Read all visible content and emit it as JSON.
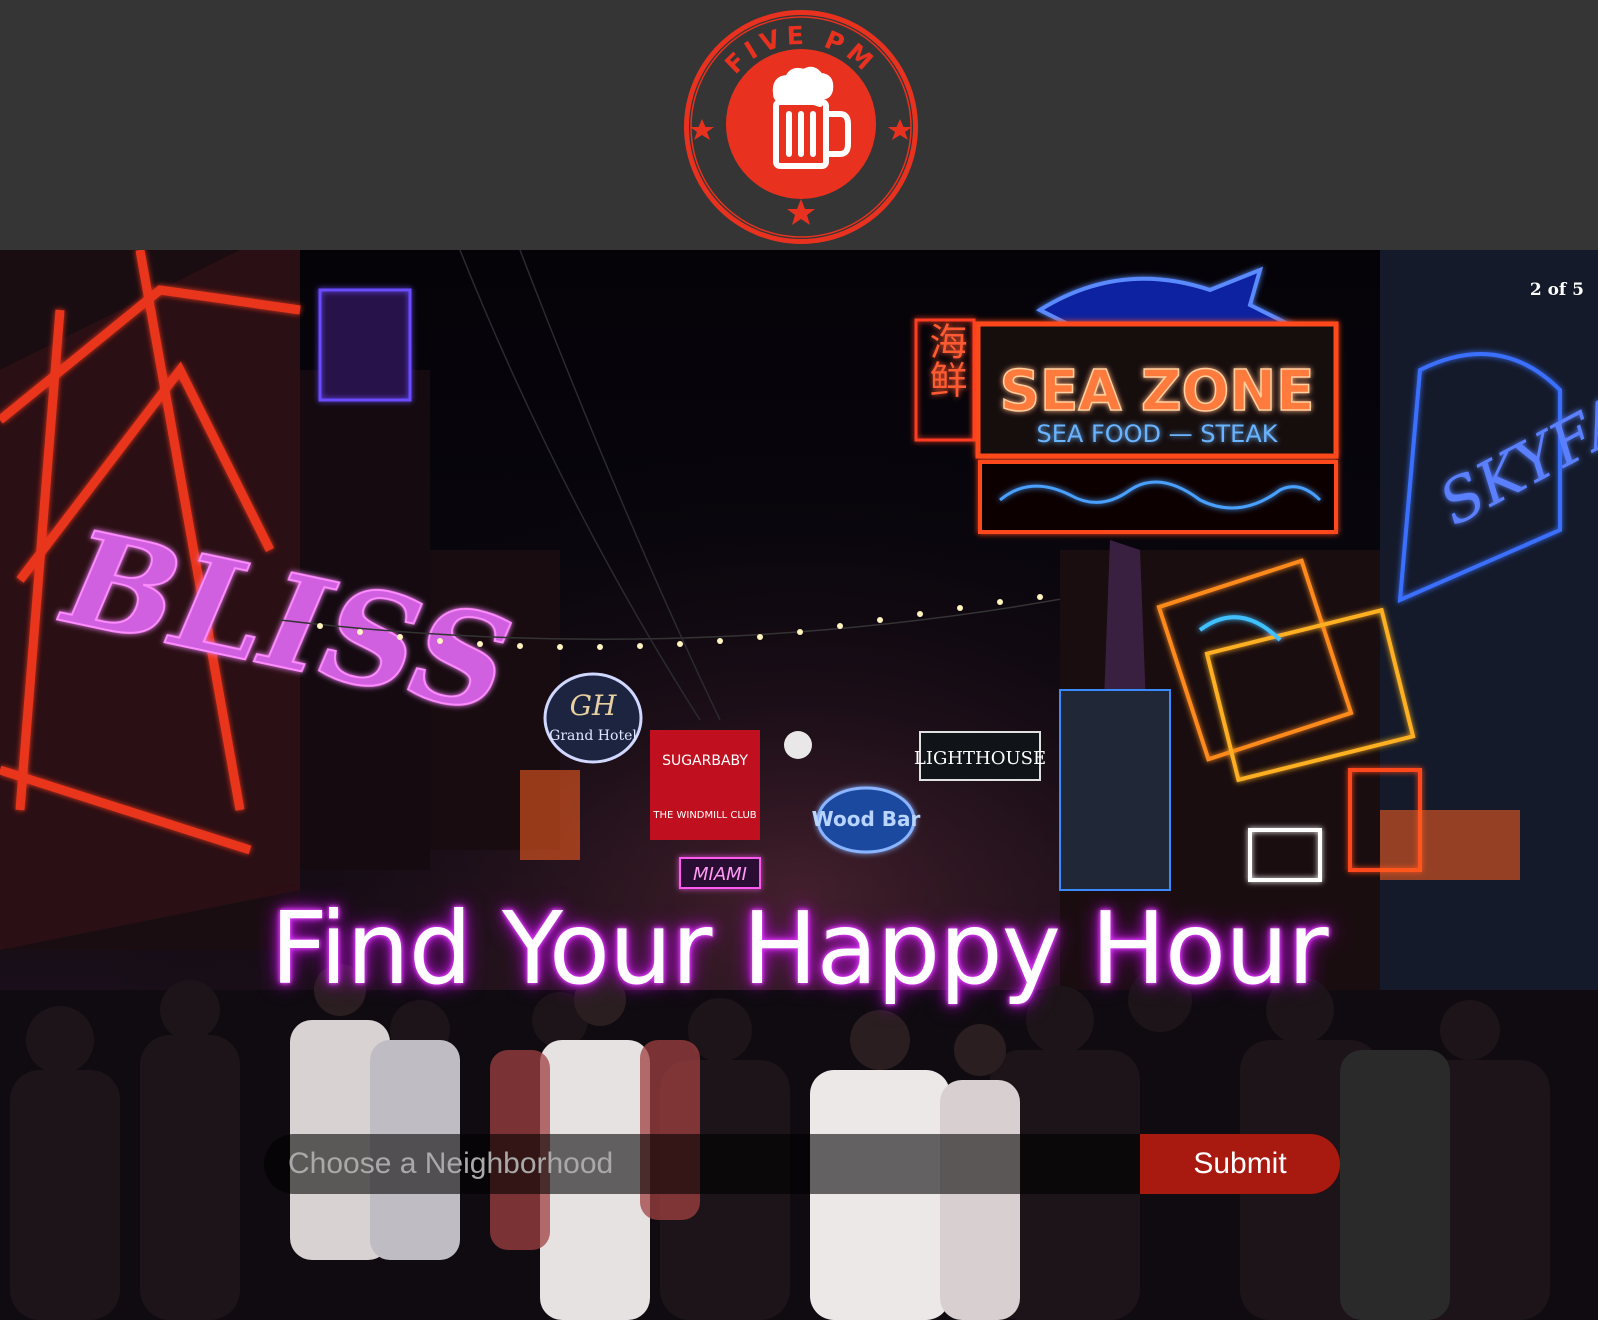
{
  "brand": {
    "name": "FIVE PM",
    "logo_icon": "beer-mug-icon",
    "colors": {
      "ring": "#e8321f",
      "header_bg": "#353535",
      "star": "#e8321f"
    }
  },
  "hero": {
    "slide_counter": "2 of 5",
    "headline": "Find Your Happy Hour",
    "headline_glow": "#d030f0",
    "signs": {
      "bliss": "BLISS",
      "sea_zone": "SEA ZONE",
      "sea_food": "SEA FOOD — STEAK",
      "chinese": "海鲜",
      "lighthouse": "LIGHTHOUSE",
      "grand_hotel": "Grand Hotel",
      "miami": "MIAMI",
      "skyfall": "SKYFALL",
      "sugarbaby": "SUGARBABY",
      "windmill": "THE WINDMILL CLUB",
      "wood_bar": "Wood Bar"
    }
  },
  "search": {
    "placeholder": "Choose a Neighborhood",
    "submit_label": "Submit",
    "submit_color": "#a81a10"
  }
}
